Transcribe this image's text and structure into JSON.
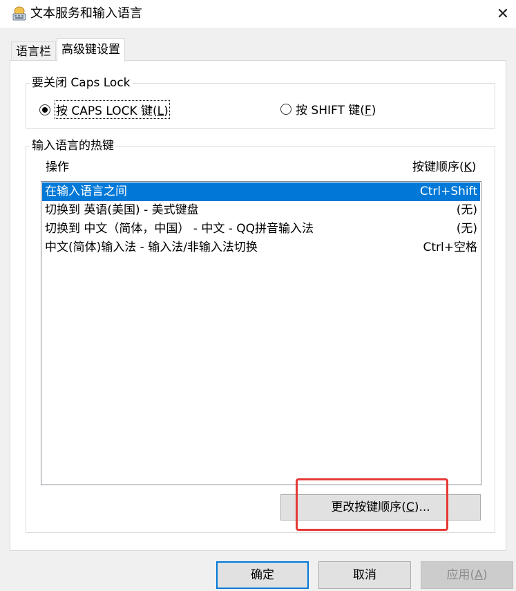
{
  "window": {
    "title": "文本服务和输入语言",
    "close_label": "✕"
  },
  "tabs": [
    {
      "label": "语言栏",
      "active": false
    },
    {
      "label": "高级键设置",
      "active": true
    }
  ],
  "caps_group": {
    "legend": "要关闭 Caps Lock",
    "options": [
      {
        "label": "按 CAPS LOCK 键(",
        "mnemonic": "L",
        "suffix": ")",
        "selected": true
      },
      {
        "label": "按 SHIFT 键(",
        "mnemonic": "F",
        "suffix": ")",
        "selected": false
      }
    ]
  },
  "hotkey_group": {
    "legend": "输入语言的热键",
    "col_action": "操作",
    "col_order_label": "按键顺序(",
    "col_order_mnemonic": "K",
    "col_order_suffix": ")",
    "rows": [
      {
        "action": "在输入语言之间",
        "keys": "Ctrl+Shift",
        "selected": true
      },
      {
        "action": "切换到 英语(美国) - 美式键盘",
        "keys": "(无)",
        "selected": false
      },
      {
        "action": "切换到 中文（简体，中国） - 中文 - QQ拼音输入法",
        "keys": "(无)",
        "selected": false
      },
      {
        "action": "中文(简体)输入法 - 输入法/非输入法切换",
        "keys": "Ctrl+空格",
        "selected": false
      }
    ],
    "change_button": {
      "label": "更改按键顺序(",
      "mnemonic": "C",
      "suffix": ")..."
    }
  },
  "footer": {
    "ok": "确定",
    "cancel": "取消",
    "apply_label": "应用(",
    "apply_mnemonic": "A",
    "apply_suffix": ")"
  },
  "colors": {
    "selection": "#0078d7",
    "highlight_box": "#e53935"
  }
}
